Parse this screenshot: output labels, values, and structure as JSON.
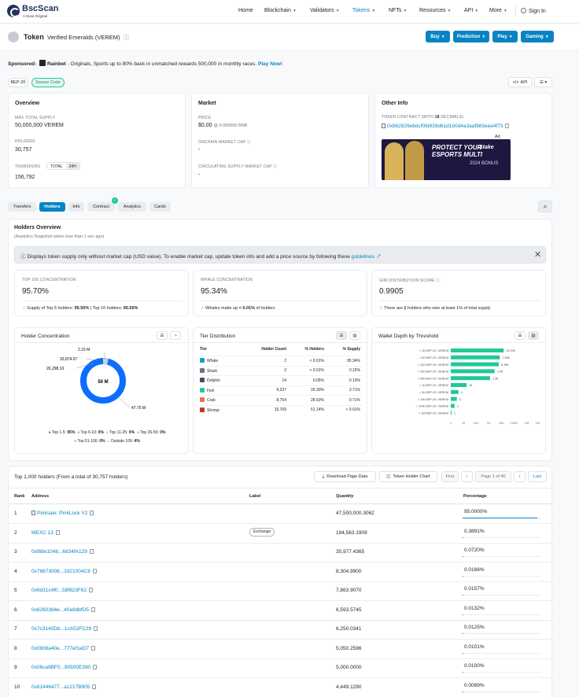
{
  "brand": {
    "name": "BscScan",
    "tagline": "A Scan Original"
  },
  "nav": [
    {
      "label": "Home",
      "caret": false
    },
    {
      "label": "Blockchain",
      "caret": true
    },
    {
      "label": "Validators",
      "caret": true
    },
    {
      "label": "Tokens",
      "caret": true
    },
    {
      "label": "NFTs",
      "caret": true
    },
    {
      "label": "Resources",
      "caret": true
    },
    {
      "label": "API",
      "caret": true
    },
    {
      "label": "More",
      "caret": true
    }
  ],
  "signin": "Sign In",
  "title": {
    "prefix": "Token",
    "name": "Verified Emeralds (VEREM)"
  },
  "title_buttons": [
    "Buy",
    "Prediction",
    "Play",
    "Gaming"
  ],
  "sponsor": {
    "label": "Sponsored:",
    "brand": "Rainbet",
    "text": " - Originals, Sports up to 80% back in unmatched rewards 500,000 in monthly races.",
    "cta": "Play Now!"
  },
  "badges": [
    "BEP-20",
    "Source Code"
  ],
  "api_label": "API",
  "overview": {
    "title": "Overview",
    "max_supply_label": "MAX TOTAL SUPPLY",
    "max_supply": "50,000,000 VEREM",
    "holders_label": "HOLDERS",
    "holders": "30,757",
    "transfers_label": "TRANSFERS",
    "transfers_toggle": [
      "TOTAL",
      "24H"
    ],
    "transfers": "156,792"
  },
  "market": {
    "title": "Market",
    "price_label": "PRICE",
    "price": "$0.00",
    "price_bnb": "@ 0.000000 BNB",
    "mcap_label": "ONCHAIN MARKET CAP",
    "mcap": "-",
    "circ_label": "CIRCULATING SUPPLY MARKET CAP",
    "circ": "-"
  },
  "other": {
    "title": "Other Info",
    "contract_label": "TOKEN CONTRACT (WITH ",
    "decimals": "18",
    "contract_label_end": " DECIMALS)",
    "contract": "0x862829e8dcf0fd939d61d1b0d4a3aaf983eee4f73",
    "ad_badge": "Ad",
    "ad_lines": [
      "PROTECT YOUR",
      "ESPORTS MULTI",
      "2024 BONUS"
    ],
    "ad_brand": "Stake"
  },
  "tabs": [
    "Transfers",
    "Holders",
    "Info",
    "Contract",
    "Analytics",
    "Cards"
  ],
  "active_tab": "Holders",
  "holders_overview": {
    "title": "Holders Overview",
    "sub": "(Analytics Snapshot taken less than 1 sec ago)",
    "notice": "Displays token supply only without market cap (USD value). To enable market cap, update token info and add a price source by following these",
    "notice_link": "guidelines"
  },
  "stats": [
    {
      "label": "TOP 100 CONCENTRATION",
      "value": "95.70%",
      "foot_a": "Supply of Top 5 holders: ",
      "foot_b": "95.50%",
      "foot_c": " | Top 10 holders: ",
      "foot_d": "95.55%"
    },
    {
      "label": "WHALE CONCENTRATION",
      "value": "95.34%",
      "foot_a": "Whales make up ",
      "foot_b": "< 0.01%",
      "foot_c": " of holders",
      "foot_d": ""
    },
    {
      "label": "GINI DISTRIBUTION SCORE",
      "value": "0.9905",
      "foot_a": "There are ",
      "foot_b": "1",
      "foot_c": " holders who own at least 1% of total supply",
      "foot_d": ""
    }
  ],
  "concentration": {
    "title": "Holder Concentration",
    "center": "50 M",
    "labels": [
      "2.15 M",
      "33,874.07",
      "26,298.10",
      "47.75 M"
    ],
    "legend": [
      {
        "label": "Top 1-5:",
        "pct": "95%",
        "color": "#0d6efd"
      },
      {
        "label": "Top 6-10:",
        "pct": "0%",
        "color": "#6fa8dc"
      },
      {
        "label": "Top 11-25:",
        "pct": "0%",
        "color": "#f4a261"
      },
      {
        "label": "Top 26-50:",
        "pct": "0%",
        "color": "#61b3e8"
      },
      {
        "label": "Top 51-100:",
        "pct": "0%",
        "color": "#b48cd9"
      },
      {
        "label": "Outside 100:",
        "pct": "4%",
        "color": "#c9d1d9"
      }
    ]
  },
  "tiers": {
    "title": "Tier Distribution",
    "headers": [
      "Tier",
      "Holder Count",
      "% Holders",
      "% Supply"
    ],
    "rows": [
      {
        "tier": "Whale",
        "count": "2",
        "holders": "< 0.01%",
        "supply": "95.34%"
      },
      {
        "tier": "Shark",
        "count": "2",
        "holders": "< 0.01%",
        "supply": "0.15%"
      },
      {
        "tier": "Dolphin",
        "count": "14",
        "holders": "0.05%",
        "supply": "0.10%"
      },
      {
        "tier": "Fish",
        "count": "6,237",
        "holders": "20.30%",
        "supply": "3.71%"
      },
      {
        "tier": "Crab",
        "count": "8,754",
        "holders": "28.50%",
        "supply": "0.71%"
      },
      {
        "tier": "Shrimp",
        "count": "15,709",
        "holders": "51.14%",
        "supply": "< 0.01%"
      }
    ]
  },
  "chart_data": {
    "type": "bar",
    "title": "Wallet Depth by Threshold",
    "orientation": "horizontal",
    "xscale": "log",
    "categories": [
      "> 10 BEP-20: VEREM",
      "> 50 BEP-20: VEREM",
      "> 100 BEP-20: VEREM",
      "> 250 BEP-20: VEREM",
      "> 500 BEP-20: VEREM",
      "> 1k BEP-20: VEREM",
      "> 5k BEP-20: VEREM",
      "> 10k BEP-20: VEREM",
      "> 100k BEP-20: VEREM",
      "> 1M BEP-20: VEREM"
    ],
    "values": [
      15096,
      7566,
      6286,
      2900,
      1300,
      18,
      4,
      3,
      2,
      1
    ],
    "data_labels": [
      "15.09K",
      "7.56K",
      "6.28K",
      "2.9K",
      "1.3K",
      "18",
      "4",
      "3",
      "2",
      "1"
    ],
    "x_ticks": [
      "1",
      "10",
      "100",
      "1K",
      "10K",
      "100K",
      "1M",
      "7M"
    ],
    "x_tick_values": [
      1,
      10,
      100,
      1000,
      10000,
      100000,
      1000000,
      7000000
    ],
    "color": "#20c997"
  },
  "holders_table": {
    "caption": "Top 1,000 holders (From a total of 30,757 holders)",
    "download": "Download Page Data",
    "chart_btn": "Token Holder Chart",
    "pager": {
      "first": "First",
      "page": "Page 1 of 40",
      "last": "Last"
    },
    "headers": [
      "Rank",
      "Address",
      "Label",
      "Quantity",
      "Percentage"
    ],
    "rows": [
      {
        "rank": "1",
        "address": "Pinksale: PinkLock V2",
        "label": "",
        "qty": "47,500,000.3062",
        "pct": "95.0000%",
        "fill": 0.95,
        "contract": true
      },
      {
        "rank": "2",
        "address": "MEXC 13",
        "label": "Exchange",
        "qty": "194,563.1909",
        "pct": "0.3891%",
        "fill": 0.0039,
        "contract": false
      },
      {
        "rank": "3",
        "address": "0xf88e1048...6834fA129",
        "label": "",
        "qty": "35,977.4365",
        "pct": "0.0720%",
        "fill": 0.0007,
        "contract": false
      },
      {
        "rank": "4",
        "address": "0x76673006...3321004C8",
        "label": "",
        "qty": "8,304.9900",
        "pct": "0.0166%",
        "fill": 0.0002,
        "contract": false
      },
      {
        "rank": "5",
        "address": "0x6d31c4f0...58f823F62",
        "label": "",
        "qty": "7,863.9070",
        "pct": "0.0157%",
        "fill": 0.0002,
        "contract": false
      },
      {
        "rank": "6",
        "address": "0x6260384e...40a9dbfD5",
        "label": "",
        "qty": "6,593.5745",
        "pct": "0.0132%",
        "fill": 0.0001,
        "contract": false
      },
      {
        "rank": "7",
        "address": "0x7c3140Db...1cA53FC29",
        "label": "",
        "qty": "6,250.0341",
        "pct": "0.0125%",
        "fill": 0.0001,
        "contract": false
      },
      {
        "rank": "8",
        "address": "0x0908a40e...777ef1eD7",
        "label": "",
        "qty": "5,050.2596",
        "pct": "0.0101%",
        "fill": 0.0001,
        "contract": false
      },
      {
        "rank": "9",
        "address": "0x06ca9BF0...90500E390",
        "label": "",
        "qty": "5,000.0000",
        "pct": "0.0100%",
        "fill": 0.0001,
        "contract": false
      },
      {
        "rank": "10",
        "address": "0x61446477...a1217B905",
        "label": "",
        "qty": "4,449.1290",
        "pct": "0.0089%",
        "fill": 0.0001,
        "contract": false
      }
    ]
  }
}
